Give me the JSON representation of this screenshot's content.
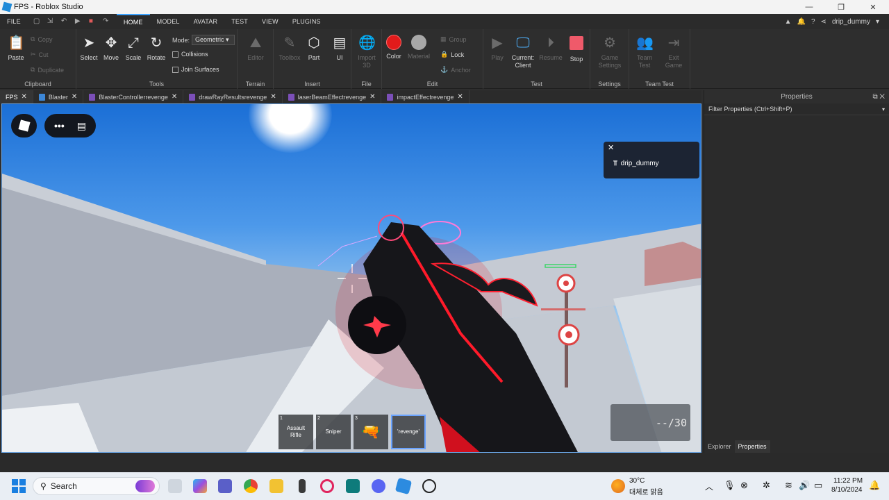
{
  "window": {
    "title": "FPS - Roblox Studio",
    "controls": [
      "—",
      "❐",
      "✕"
    ]
  },
  "menubar": {
    "file": "FILE",
    "tabs": [
      "HOME",
      "MODEL",
      "AVATAR",
      "TEST",
      "VIEW",
      "PLUGINS"
    ],
    "active_tab": "HOME",
    "user": "drip_dummy"
  },
  "ribbon": {
    "clipboard": {
      "label": "Clipboard",
      "paste": "Paste",
      "copy": "Copy",
      "cut": "Cut",
      "duplicate": "Duplicate"
    },
    "tools": {
      "label": "Tools",
      "select": "Select",
      "move": "Move",
      "scale": "Scale",
      "rotate": "Rotate",
      "mode_label": "Mode:",
      "mode_value": "Geometric",
      "collisions": "Collisions",
      "join_surfaces": "Join Surfaces"
    },
    "terrain": {
      "label": "Terrain",
      "editor": "Editor"
    },
    "insert": {
      "label": "Insert",
      "toolbox": "Toolbox",
      "part": "Part",
      "ui": "UI"
    },
    "file": {
      "label": "File",
      "import": "Import",
      "import2": "3D"
    },
    "edit": {
      "label": "Edit",
      "color": "Color",
      "material": "Material",
      "group": "Group",
      "lock": "Lock",
      "anchor": "Anchor"
    },
    "test": {
      "label": "Test",
      "play": "Play",
      "current": "Current:",
      "client": "Client",
      "resume": "Resume",
      "stop": "Stop"
    },
    "settings": {
      "label": "Settings",
      "game": "Game",
      "settings": "Settings"
    },
    "teamtest": {
      "label": "Team Test",
      "team": "Team",
      "test": "Test",
      "exit": "Exit",
      "game": "Game"
    }
  },
  "doc_tabs": [
    {
      "label": "FPS",
      "type": "place"
    },
    {
      "label": "Blaster",
      "type": "blue"
    },
    {
      "label": "BlasterControllerrevenge",
      "type": "script"
    },
    {
      "label": "drawRayResultsrevenge",
      "type": "script"
    },
    {
      "label": "laserBeamEffectrevenge",
      "type": "script"
    },
    {
      "label": "impactEffectrevenge",
      "type": "script"
    }
  ],
  "viewport": {
    "notification_user": "drip_dummy",
    "hotbar": [
      {
        "num": "1",
        "label": "Assault Rifle"
      },
      {
        "num": "2",
        "label": "Sniper"
      },
      {
        "num": "3",
        "label": ""
      },
      {
        "num": "",
        "label": "'revenge'"
      }
    ],
    "ammo": "--/30"
  },
  "properties": {
    "title": "Properties",
    "filter_placeholder": "Filter Properties (Ctrl+Shift+P)",
    "bottom_tabs": [
      "Explorer",
      "Properties"
    ]
  },
  "taskbar": {
    "search": "Search",
    "weather_temp": "30°C",
    "weather_desc": "대체로 맑음",
    "time": "11:22 PM",
    "date": "8/10/2024"
  }
}
